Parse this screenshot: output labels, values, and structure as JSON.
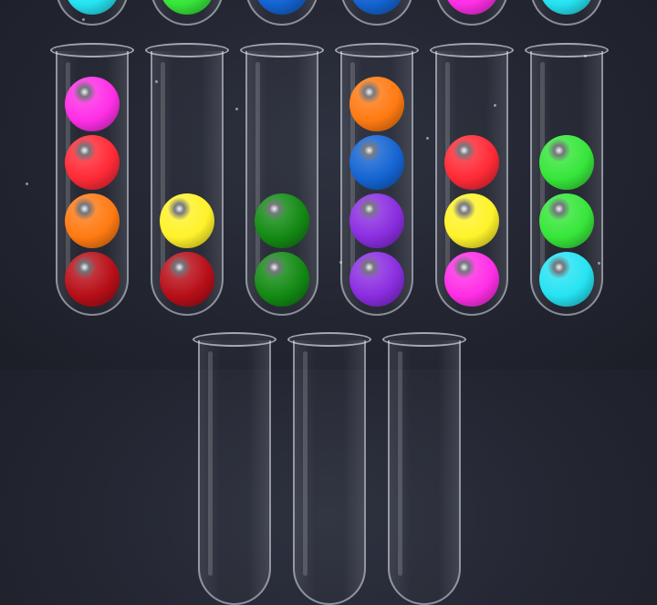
{
  "colors": {
    "magenta": "#ff2ee6",
    "red": "#ff2a36",
    "orange": "#ff7a12",
    "dark_red": "#b80f18",
    "yellow": "#fff22a",
    "dark_green": "#138a14",
    "blue": "#1464d2",
    "purple": "#8a2de0",
    "green": "#36e63a",
    "cyan": "#26e3f2"
  },
  "top_row_partial": [
    "cyan",
    "green",
    "blue",
    "blue",
    "magenta",
    "cyan"
  ],
  "tubes": [
    {
      "balls": [
        "dark_red",
        "orange",
        "red",
        "magenta"
      ]
    },
    {
      "balls": [
        "dark_red",
        "yellow"
      ]
    },
    {
      "balls": [
        "dark_green",
        "dark_green"
      ]
    },
    {
      "balls": [
        "purple",
        "purple",
        "blue",
        "orange"
      ]
    },
    {
      "balls": [
        "magenta",
        "yellow",
        "red"
      ]
    },
    {
      "balls": [
        "cyan",
        "green",
        "green"
      ]
    }
  ],
  "bottom_row_partial": [
    {
      "balls": []
    },
    {
      "balls": []
    },
    {
      "balls": []
    }
  ]
}
